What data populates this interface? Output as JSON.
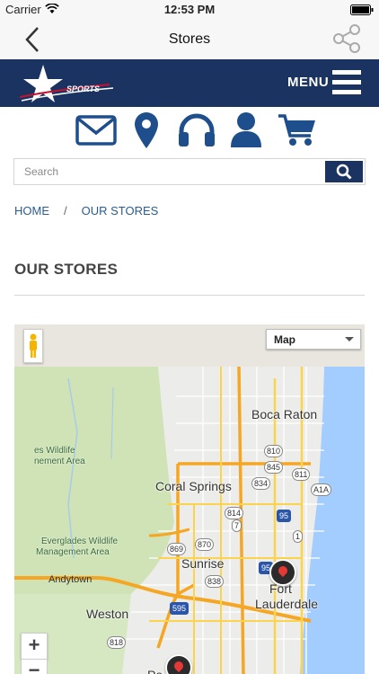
{
  "status_bar": {
    "carrier": "Carrier",
    "time": "12:53 PM"
  },
  "nav_bar": {
    "title": "Stores",
    "icons": [
      "back-chevron-icon",
      "share-icon"
    ]
  },
  "site_header": {
    "logo_text": "SPORTS",
    "menu_label": "MENU",
    "brand_color": "#1a3361"
  },
  "quick_icons": [
    "mail-icon",
    "location-pin-icon",
    "headphones-icon",
    "user-icon",
    "cart-icon"
  ],
  "search": {
    "placeholder": "Search",
    "value": ""
  },
  "breadcrumb": {
    "home": "HOME",
    "separator": "/",
    "current": "OUR STORES"
  },
  "page": {
    "heading": "OUR STORES"
  },
  "map": {
    "type_selected": "Map",
    "zoom_in": "+",
    "zoom_out": "−",
    "labels": {
      "boca_raton": "Boca Raton",
      "coral_springs": "Coral Springs",
      "sunrise": "Sunrise",
      "fort": "Fort",
      "lauderdale": "Lauderdale",
      "weston": "Weston",
      "andytown": "Andytown",
      "wildlife_1a": "es Wildlife",
      "wildlife_1b": "nement Area",
      "wildlife_2a": "Everglades Wildlife",
      "wildlife_2b": "Management Area",
      "partial_bottom": "Pe"
    },
    "shields": {
      "s810": "810",
      "s845": "845",
      "s811": "811",
      "s834": "834",
      "a1a": "A1A",
      "s814": "814",
      "s7": "7",
      "s95a": "95",
      "s1": "1",
      "s869": "869",
      "s870": "870",
      "s838": "838",
      "s95b": "95",
      "s595": "595",
      "s818": "818"
    }
  }
}
